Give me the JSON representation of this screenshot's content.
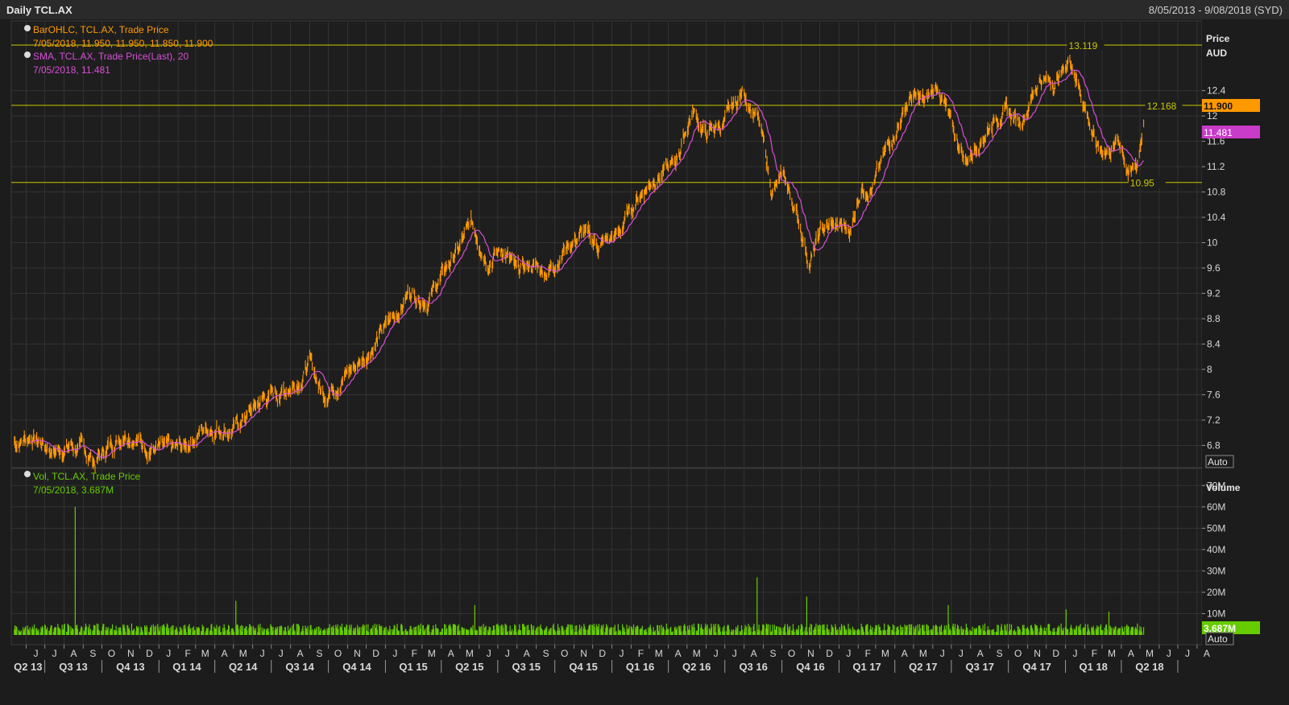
{
  "header": {
    "title": "Daily TCL.AX",
    "date_range": "8/05/2013 - 9/08/2018 (SYD)"
  },
  "colors": {
    "background": "#1e1e1e",
    "grid": "#333333",
    "price": "#ff9900",
    "sma": "#d64fd6",
    "level_line": "#c8c800",
    "volume": "#66cc00",
    "axis_text": "#d8d8d8"
  },
  "price_panel": {
    "legend_ohlc": "BarOHLC, TCL.AX, Trade Price",
    "legend_ohlc_values": "7/05/2018, 11.950, 11.950, 11.850, 11.900",
    "legend_sma": "SMA, TCL.AX, Trade Price(Last),  20",
    "legend_sma_values": "7/05/2018, 11.481",
    "axis_title": "Price",
    "axis_unit": "AUD",
    "last_price_tag": "11.900",
    "sma_tag": "11.481",
    "auto_button": "Auto"
  },
  "volume_panel": {
    "legend": "Vol, TCL.AX, Trade Price",
    "legend_values": "7/05/2018, 3.687M",
    "axis_title": "Volume",
    "last_volume_tag": "3.687M",
    "auto_button": "Auto"
  },
  "chart_data": [
    {
      "type": "line",
      "series": [
        {
          "name": "BarOHLC, TCL.AX, Trade Price"
        },
        {
          "name": "SMA, TCL.AX, Trade Price(Last), 20"
        }
      ],
      "x_range": [
        "2013-05-08",
        "2018-08-09"
      ],
      "x_last": "2018-05-07",
      "ylim": [
        6.45,
        13.5
      ],
      "y_ticks": [
        "6.8",
        "7.2",
        "7.6",
        "8",
        "8.4",
        "8.8",
        "9.2",
        "9.6",
        "10",
        "10.4",
        "10.8",
        "11.2",
        "11.6",
        "12",
        "12.4"
      ],
      "price_points": [
        [
          "2013-05-13",
          6.85
        ],
        [
          "2013-06-10",
          6.95
        ],
        [
          "2013-07-15",
          6.72
        ],
        [
          "2013-08-12",
          6.8
        ],
        [
          "2013-09-02",
          6.7
        ],
        [
          "2013-09-20",
          6.55
        ],
        [
          "2013-10-20",
          6.85
        ],
        [
          "2013-11-10",
          7.05
        ],
        [
          "2013-12-10",
          6.8
        ],
        [
          "2014-01-20",
          6.7
        ],
        [
          "2014-02-10",
          6.75
        ],
        [
          "2014-03-10",
          7.05
        ],
        [
          "2014-04-10",
          7.1
        ],
        [
          "2014-05-01",
          7.05
        ],
        [
          "2014-05-20",
          7.25
        ],
        [
          "2014-06-20",
          7.55
        ],
        [
          "2014-07-20",
          7.65
        ],
        [
          "2014-08-15",
          7.85
        ],
        [
          "2014-09-01",
          8.1
        ],
        [
          "2014-09-22",
          7.6
        ],
        [
          "2014-10-20",
          7.85
        ],
        [
          "2014-11-20",
          8.1
        ],
        [
          "2014-12-20",
          8.5
        ],
        [
          "2015-01-20",
          8.9
        ],
        [
          "2015-02-10",
          9.25
        ],
        [
          "2015-03-10",
          9.1
        ],
        [
          "2015-04-10",
          9.6
        ],
        [
          "2015-04-30",
          9.9
        ],
        [
          "2015-05-20",
          10.3
        ],
        [
          "2015-06-15",
          9.75
        ],
        [
          "2015-07-10",
          9.9
        ],
        [
          "2015-08-01",
          9.5
        ],
        [
          "2015-08-25",
          9.65
        ],
        [
          "2015-09-20",
          9.55
        ],
        [
          "2015-10-20",
          9.95
        ],
        [
          "2015-11-15",
          10.15
        ],
        [
          "2015-12-10",
          9.95
        ],
        [
          "2016-01-10",
          10.1
        ],
        [
          "2016-02-10",
          10.7
        ],
        [
          "2016-03-10",
          11.05
        ],
        [
          "2016-04-10",
          11.2
        ],
        [
          "2016-05-10",
          12.1
        ],
        [
          "2016-06-01",
          11.7
        ],
        [
          "2016-07-01",
          11.9
        ],
        [
          "2016-08-01",
          12.4
        ],
        [
          "2016-08-25",
          11.9
        ],
        [
          "2016-09-15",
          10.8
        ],
        [
          "2016-10-05",
          11.0
        ],
        [
          "2016-10-25",
          10.45
        ],
        [
          "2016-11-15",
          9.7
        ],
        [
          "2016-12-05",
          10.2
        ],
        [
          "2016-12-25",
          10.25
        ],
        [
          "2017-01-20",
          10.2
        ],
        [
          "2017-02-05",
          10.9
        ],
        [
          "2017-02-25",
          10.9
        ],
        [
          "2017-03-25",
          11.6
        ],
        [
          "2017-04-25",
          12.3
        ],
        [
          "2017-05-20",
          12.2
        ],
        [
          "2017-06-10",
          12.5
        ],
        [
          "2017-07-05",
          11.7
        ],
        [
          "2017-07-25",
          11.3
        ],
        [
          "2017-08-20",
          11.7
        ],
        [
          "2017-09-20",
          12.1
        ],
        [
          "2017-10-20",
          11.9
        ],
        [
          "2017-11-20",
          12.6
        ],
        [
          "2017-12-10",
          12.5
        ],
        [
          "2017-12-28",
          12.7
        ],
        [
          "2018-01-10",
          12.9
        ],
        [
          "2018-02-01",
          12.2
        ],
        [
          "2018-02-20",
          11.5
        ],
        [
          "2018-03-10",
          11.45
        ],
        [
          "2018-03-31",
          11.6
        ],
        [
          "2018-04-15",
          11.05
        ],
        [
          "2018-04-27",
          11.25
        ],
        [
          "2018-05-07",
          11.9
        ]
      ],
      "sma_last": 11.481,
      "last_close": 11.9
    },
    {
      "type": "bar",
      "series": [
        {
          "name": "Vol, TCL.AX, Trade Price"
        }
      ],
      "ylim": [
        0,
        75
      ],
      "y_unit": "M",
      "y_ticks": [
        "10M",
        "20M",
        "30M",
        "40M",
        "50M",
        "60M",
        "70M"
      ],
      "typical_volume": 3,
      "spikes": [
        [
          "2013-08-19",
          60
        ],
        [
          "2014-05-05",
          16
        ],
        [
          "2015-05-25",
          14
        ],
        [
          "2016-08-22",
          27
        ],
        [
          "2016-11-10",
          18
        ],
        [
          "2017-06-26",
          14
        ],
        [
          "2018-01-02",
          12
        ],
        [
          "2018-03-12",
          11
        ]
      ],
      "last_volume": 3.687
    }
  ],
  "horizontal_levels": [
    {
      "value": 13.119,
      "label": "13.119"
    },
    {
      "value": 12.168,
      "label": "12.168"
    },
    {
      "value": 10.95,
      "label": "10.95"
    }
  ],
  "x_axis": {
    "months": [
      "J",
      "J",
      "A",
      "S",
      "O",
      "N",
      "D",
      "J",
      "F",
      "M",
      "A",
      "M",
      "J",
      "J",
      "A",
      "S",
      "O",
      "N",
      "D",
      "J",
      "F",
      "M",
      "A",
      "M",
      "J",
      "J",
      "A",
      "S",
      "O",
      "N",
      "D",
      "J",
      "F",
      "M",
      "A",
      "M",
      "J",
      "J",
      "A",
      "S",
      "O",
      "N",
      "D",
      "J",
      "F",
      "M",
      "A",
      "M",
      "J",
      "J",
      "A",
      "S",
      "O",
      "N",
      "D",
      "J",
      "F",
      "M",
      "A",
      "M",
      "J",
      "J",
      "A"
    ],
    "quarters": [
      "Q2 13",
      "Q3 13",
      "Q4 13",
      "Q1 14",
      "Q2 14",
      "Q3 14",
      "Q4 14",
      "Q1 15",
      "Q2 15",
      "Q3 15",
      "Q4 15",
      "Q1 16",
      "Q2 16",
      "Q3 16",
      "Q4 16",
      "Q1 17",
      "Q2 17",
      "Q3 17",
      "Q4 17",
      "Q1 18",
      "Q2 18"
    ]
  }
}
